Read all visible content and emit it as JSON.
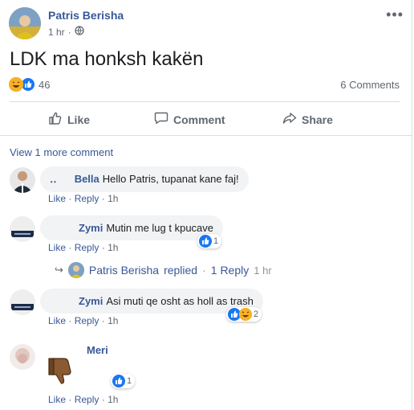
{
  "post": {
    "author": "Patris Berisha",
    "time": "1 hr",
    "separator": "·",
    "text": "LDK ma honksh kakën",
    "reaction_count": "46",
    "comments_count": "6 Comments",
    "menu_dots": "•••"
  },
  "actions": {
    "like": "Like",
    "comment": "Comment",
    "share": "Share"
  },
  "view_more": "View 1 more comment",
  "comments": [
    {
      "name": "Bella",
      "name_prefix": "‥",
      "text": "Hello Patris, tupanat kane faj!",
      "like": "Like",
      "reply": "Reply",
      "time": "1h"
    },
    {
      "name": "Zymi",
      "text": "Mutin me lug t kpucave",
      "like": "Like",
      "reply": "Reply",
      "time": "1h",
      "reactions": "1"
    },
    {
      "name": "Zymi",
      "text": "Asi muti qe osht as holl as trash",
      "like": "Like",
      "reply": "Reply",
      "time": "1h",
      "reactions": "2"
    },
    {
      "name": "Meri",
      "like": "Like",
      "reply": "Reply",
      "time": "1h",
      "reactions": "1"
    }
  ],
  "reply_summary": {
    "arrow": "↪",
    "author": "Patris Berisha",
    "verb": "replied",
    "sep": "·",
    "count": "1 Reply",
    "time": "1 hr"
  },
  "colors": {
    "link": "#385898",
    "like_blue": "#1877f2",
    "haha_yellow": "#f7b125",
    "bubble_bg": "#f2f3f5",
    "muted": "#606770"
  },
  "icons": {
    "globe": "globe-icon",
    "like": "thumbs-up-icon",
    "comment": "speech-bubble-icon",
    "share": "share-arrow-icon",
    "dislike_sticker": "thumbs-down-sticker"
  }
}
